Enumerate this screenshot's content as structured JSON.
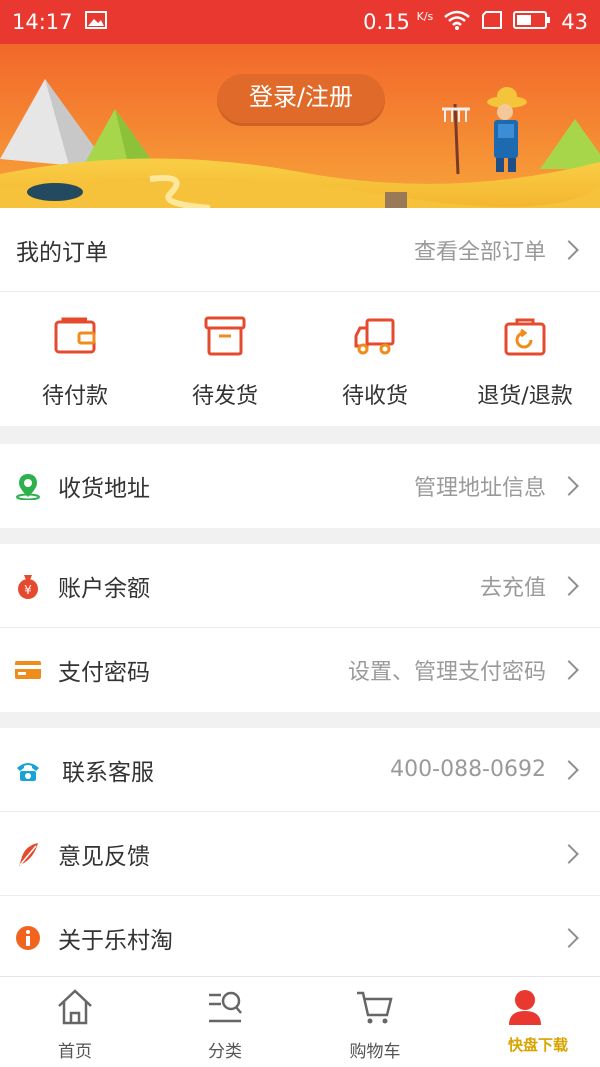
{
  "status_bar": {
    "time": "14:17",
    "speed": "0.15",
    "speed_unit": "K/s",
    "battery": "43"
  },
  "banner": {
    "login_label": "登录/注册"
  },
  "orders": {
    "title": "我的订单",
    "view_all": "查看全部订单",
    "items": [
      {
        "label": "待付款",
        "icon": "wallet-icon"
      },
      {
        "label": "待发货",
        "icon": "box-icon"
      },
      {
        "label": "待收货",
        "icon": "truck-icon"
      },
      {
        "label": "退货/退款",
        "icon": "return-bag-icon"
      }
    ]
  },
  "menu": {
    "address": {
      "label": "收货地址",
      "value": "管理地址信息",
      "icon": "location-pin-icon"
    },
    "balance": {
      "label": "账户余额",
      "value": "去充值",
      "icon": "money-bag-icon"
    },
    "pay_password": {
      "label": "支付密码",
      "value": "设置、管理支付密码",
      "icon": "card-icon"
    },
    "service": {
      "label": "联系客服",
      "value": "400-088-0692",
      "icon": "phone-icon"
    },
    "feedback": {
      "label": "意见反馈",
      "value": "",
      "icon": "feather-icon"
    },
    "about": {
      "label": "关于乐村淘",
      "value": "",
      "icon": "info-icon"
    }
  },
  "tabbar": {
    "home": "首页",
    "category": "分类",
    "cart": "购物车"
  },
  "watermark": "快盘下载",
  "colors": {
    "accent": "#e8382f",
    "icon_red": "#e54a2f",
    "green": "#2db14c",
    "orange": "#f08c1c",
    "teal": "#1aa3d6"
  }
}
